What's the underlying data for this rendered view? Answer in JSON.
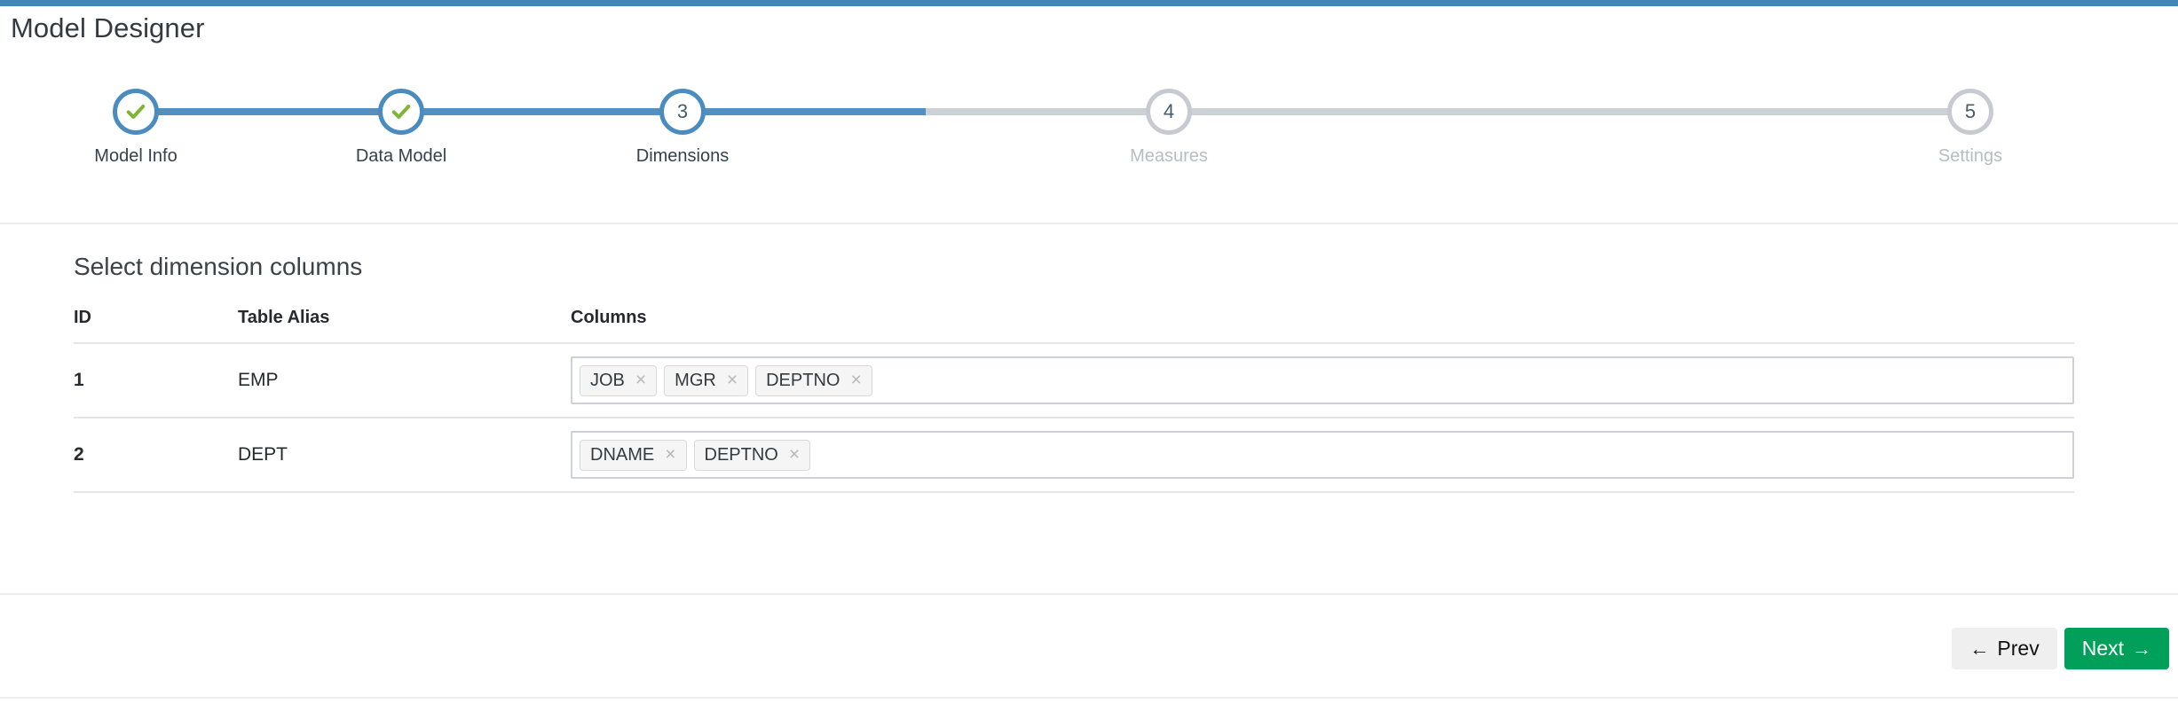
{
  "theme": {
    "accent_bar": "#3f87b5",
    "stepper_active": "#4a8cbf",
    "stepper_inactive": "#c7cbd1",
    "check_green": "#7fb539",
    "next_green": "#00a05a"
  },
  "header": {
    "title": "Model Designer"
  },
  "stepper": {
    "steps": [
      {
        "number": "1",
        "label": "Model Info",
        "state": "done",
        "marker": "check-icon"
      },
      {
        "number": "2",
        "label": "Data Model",
        "state": "done",
        "marker": "check-icon"
      },
      {
        "number": "3",
        "label": "Dimensions",
        "state": "active",
        "marker": "3"
      },
      {
        "number": "4",
        "label": "Measures",
        "state": "inactive",
        "marker": "4"
      },
      {
        "number": "5",
        "label": "Settings",
        "state": "inactive",
        "marker": "5"
      }
    ],
    "progress_percent": 50
  },
  "main": {
    "section_title": "Select dimension columns",
    "table": {
      "headers": [
        "ID",
        "Table Alias",
        "Columns"
      ],
      "rows": [
        {
          "id": "1",
          "alias": "EMP",
          "columns": [
            "JOB",
            "MGR",
            "DEPTNO"
          ]
        },
        {
          "id": "2",
          "alias": "DEPT",
          "columns": [
            "DNAME",
            "DEPTNO"
          ]
        }
      ],
      "tag_remove_glyph": "×"
    }
  },
  "footer": {
    "prev_label": "Prev",
    "prev_arrow": "←",
    "next_label": "Next",
    "next_arrow": "→"
  }
}
